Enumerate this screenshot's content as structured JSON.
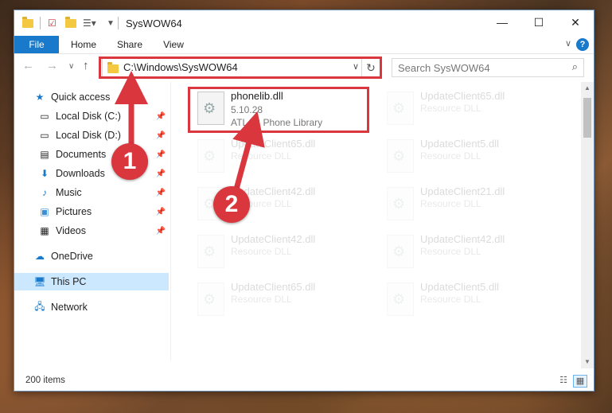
{
  "window": {
    "title": "SysWOW64",
    "controls": {
      "minimize": "—",
      "maximize": "☐",
      "close": "✕"
    }
  },
  "ribbon": {
    "tabs": [
      "File",
      "Home",
      "Share",
      "View"
    ],
    "help": "?",
    "collapse_icon": "chevron-down-icon"
  },
  "address": {
    "path": "C:\\Windows\\SysWOW64",
    "search_placeholder": "Search SysWOW64"
  },
  "nav": {
    "quick_access": "Quick access",
    "items": [
      {
        "label": "Local Disk (C:)",
        "icon": "drive-icon",
        "pinned": true
      },
      {
        "label": "Local Disk (D:)",
        "icon": "drive-icon",
        "pinned": true
      },
      {
        "label": "Documents",
        "icon": "documents-icon",
        "pinned": true
      },
      {
        "label": "Downloads",
        "icon": "downloads-icon",
        "pinned": true
      },
      {
        "label": "Music",
        "icon": "music-icon",
        "pinned": true
      },
      {
        "label": "Pictures",
        "icon": "pictures-icon",
        "pinned": true
      },
      {
        "label": "Videos",
        "icon": "videos-icon",
        "pinned": true
      }
    ],
    "onedrive": "OneDrive",
    "this_pc": "This PC",
    "network": "Network"
  },
  "files": {
    "highlighted": {
      "name": "phonelib.dll",
      "version": "5.10.28",
      "description": "ATLAS Phone Library"
    },
    "ghost": [
      {
        "name": "UpdateClient65.dll",
        "type": "Resource DLL"
      },
      {
        "name": "UpdateClient65.dll",
        "type": "Resource DLL"
      },
      {
        "name": "UpdateClient5.dll",
        "type": "Resource DLL"
      },
      {
        "name": "UpdateClient42.dll",
        "type": "Resource DLL"
      },
      {
        "name": "UpdateClient21.dll",
        "type": "Resource DLL"
      },
      {
        "name": "UpdateClient42.dll",
        "type": "Resource DLL"
      },
      {
        "name": "UpdateClient42.dll",
        "type": "Resource DLL"
      },
      {
        "name": "UpdateClient65.dll",
        "type": "Resource DLL"
      },
      {
        "name": "UpdateClient5.dll",
        "type": "Resource DLL"
      }
    ]
  },
  "status": {
    "count": "200 items"
  },
  "annotations": {
    "step1": "1",
    "step2": "2"
  },
  "colors": {
    "accent": "#1979ca",
    "annotation": "#d9363e",
    "selection": "#cce8ff"
  }
}
